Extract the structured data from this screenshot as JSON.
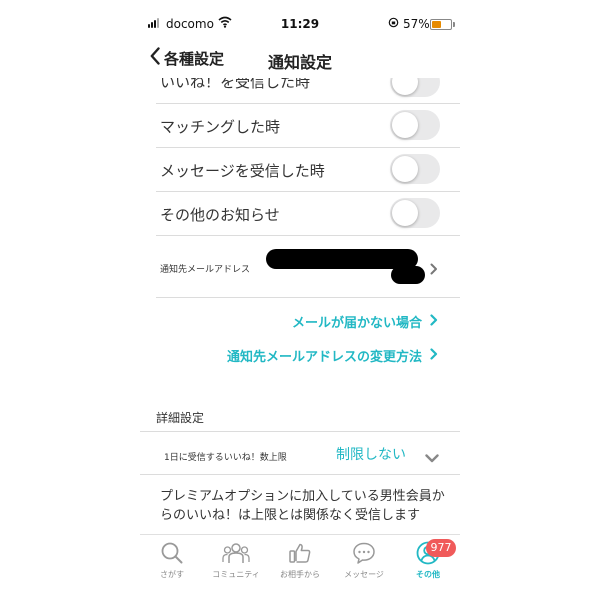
{
  "status_bar": {
    "carrier": "docomo",
    "time": "11:29",
    "battery": "57%",
    "battery_level": 0.57
  },
  "nav": {
    "back_label": "各種設定",
    "title": "通知設定"
  },
  "notifications": [
    {
      "label": "いいね！を受信した時",
      "enabled": false
    },
    {
      "label": "マッチングした時",
      "enabled": false
    },
    {
      "label": "メッセージを受信した時",
      "enabled": false
    },
    {
      "label": "その他のお知らせ",
      "enabled": false
    }
  ],
  "email_row": {
    "label": "通知先メールアドレス"
  },
  "links": {
    "not_received": "メールが届かない場合",
    "change_method": "通知先メールアドレスの変更方法"
  },
  "details": {
    "header": "詳細設定",
    "limit_label": "1日に受信するいいね！数上限",
    "limit_value": "制限しない",
    "note": "プレミアムオプションに加入している男性会員からのいいね！は上限とは関係なく受信します"
  },
  "tabbar": {
    "tabs": [
      {
        "label": "さがす",
        "icon": "search-icon"
      },
      {
        "label": "コミュニティ",
        "icon": "community-icon"
      },
      {
        "label": "お相手から",
        "icon": "thumbs-up-icon"
      },
      {
        "label": "メッセージ",
        "icon": "message-icon"
      },
      {
        "label": "その他",
        "icon": "profile-icon",
        "active": true
      }
    ],
    "badge": "977"
  },
  "colors": {
    "accent": "#22b8c4",
    "badge": "#f05a5a",
    "battery": "#e68a00"
  }
}
